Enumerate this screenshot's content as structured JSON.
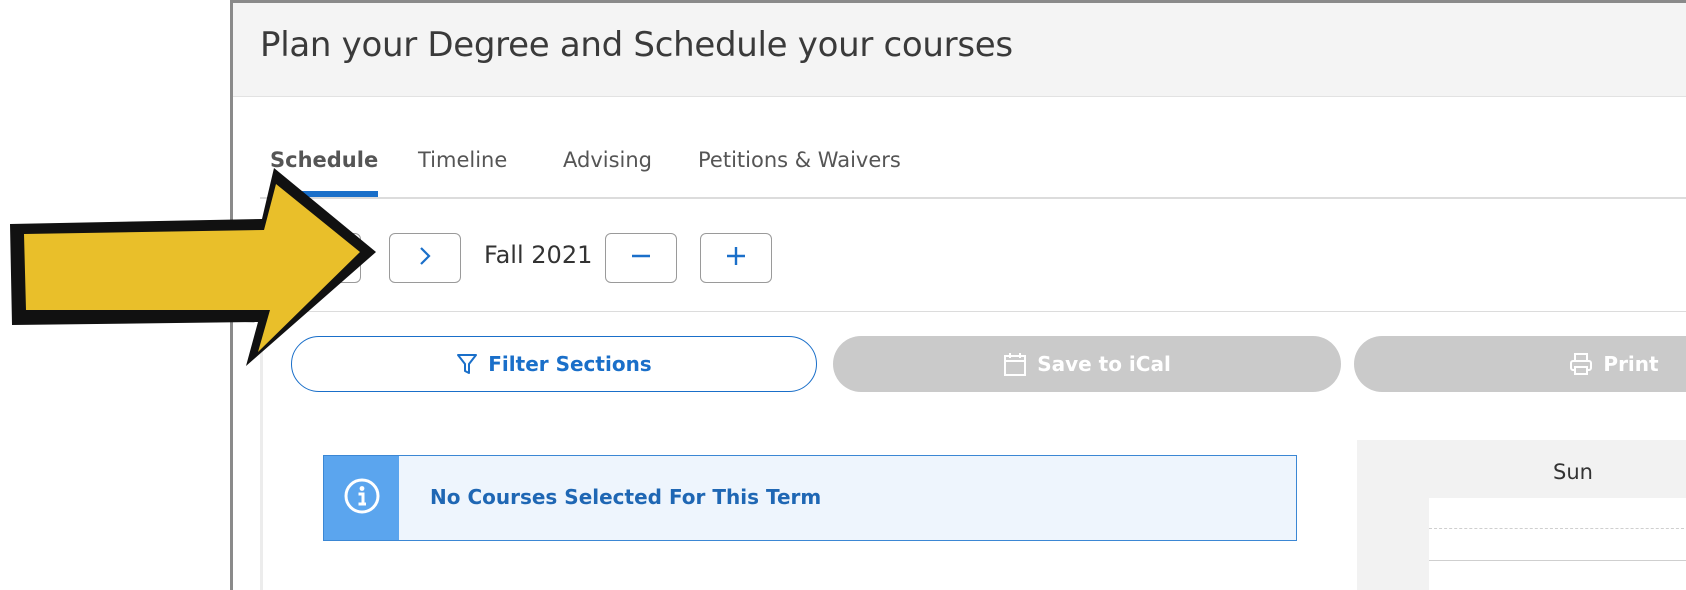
{
  "header": {
    "title": "Plan your Degree and Schedule your courses"
  },
  "tabs": [
    {
      "label": "Schedule",
      "active": true
    },
    {
      "label": "Timeline",
      "active": false
    },
    {
      "label": "Advising",
      "active": false
    },
    {
      "label": "Petitions & Waivers",
      "active": false
    }
  ],
  "term": {
    "label": "Fall 2021"
  },
  "actions": {
    "filter_label": "Filter Sections",
    "ical_label": "Save to iCal",
    "print_label": "Print"
  },
  "alert": {
    "text": "No Courses Selected For This Term"
  },
  "calendar": {
    "day": "Sun"
  },
  "colors": {
    "accent": "#1a6fc9",
    "disabled_button": "#cacaca",
    "alert_bg": "#eef5fd",
    "alert_icon_bg": "#5ba5ee",
    "arrow_fill": "#e9bf2a"
  },
  "icons": [
    "chevron-right-icon",
    "minus-icon",
    "plus-icon",
    "funnel-icon",
    "calendar-icon",
    "printer-icon",
    "info-icon",
    "yellow-arrow-annotation"
  ]
}
